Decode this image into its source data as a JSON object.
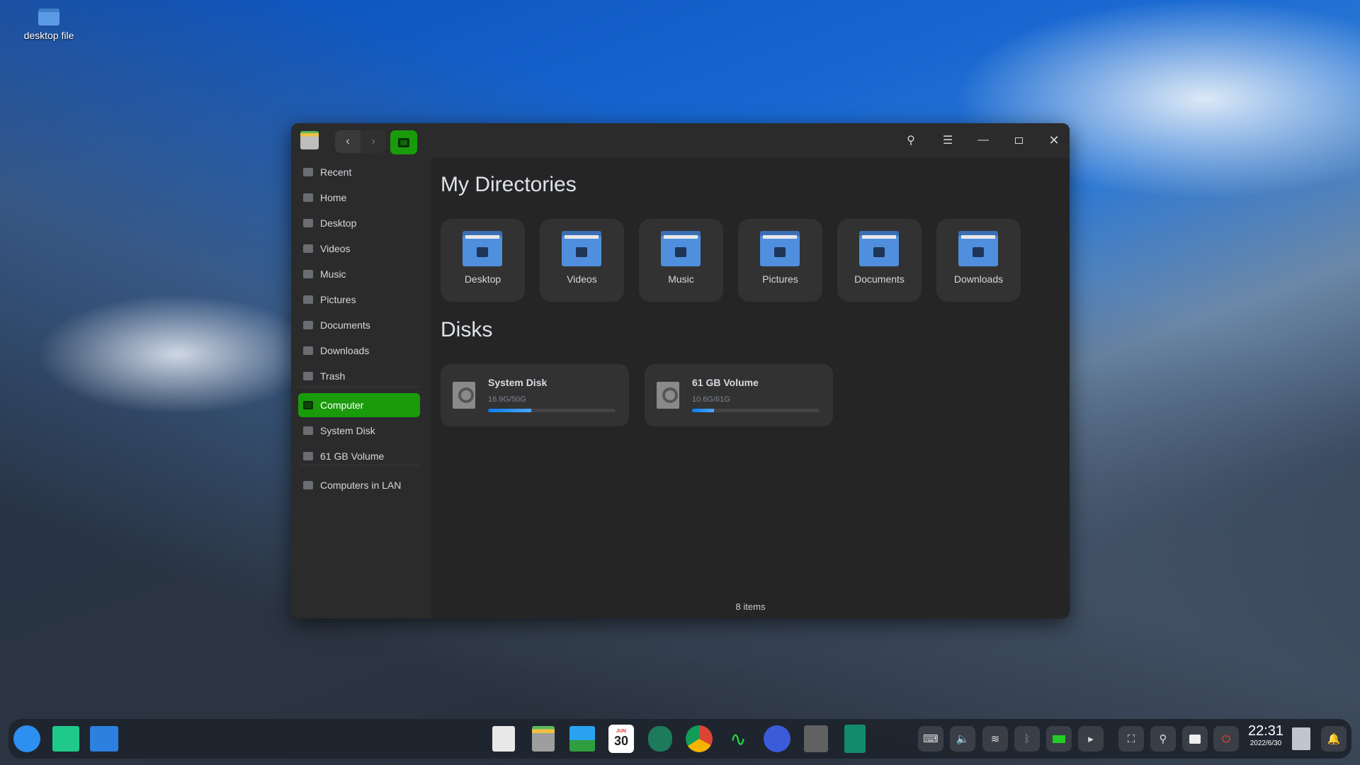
{
  "desktop": {
    "icon_label": "desktop file"
  },
  "window": {
    "nav": {
      "back": "back",
      "forward": "forward",
      "computer_view": "computer"
    },
    "sidebar": {
      "items": [
        {
          "label": "Recent",
          "icon": "clock-icon"
        },
        {
          "label": "Home",
          "icon": "home-icon"
        },
        {
          "label": "Desktop",
          "icon": "desktop-icon"
        },
        {
          "label": "Videos",
          "icon": "video-icon"
        },
        {
          "label": "Music",
          "icon": "music-icon"
        },
        {
          "label": "Pictures",
          "icon": "picture-icon"
        },
        {
          "label": "Documents",
          "icon": "document-icon"
        },
        {
          "label": "Downloads",
          "icon": "download-icon"
        },
        {
          "label": "Trash",
          "icon": "trash-icon"
        },
        {
          "label": "Computer",
          "icon": "computer-icon",
          "active": true
        },
        {
          "label": "System Disk",
          "icon": "disk-icon"
        },
        {
          "label": "61 GB Volume",
          "icon": "disk-icon"
        },
        {
          "label": "Computers in LAN",
          "icon": "network-icon"
        }
      ]
    },
    "main": {
      "directories_title": "My Directories",
      "directories": [
        {
          "label": "Desktop"
        },
        {
          "label": "Videos"
        },
        {
          "label": "Music"
        },
        {
          "label": "Pictures"
        },
        {
          "label": "Documents"
        },
        {
          "label": "Downloads"
        }
      ],
      "disks_title": "Disks",
      "disks": [
        {
          "name": "System Disk",
          "usage": "16.9G/50G",
          "used_fraction": 0.338
        },
        {
          "name": "61 GB Volume",
          "usage": "10.6G/61G",
          "used_fraction": 0.174
        }
      ],
      "status": "8 items"
    },
    "accent": "#1a9b0c"
  },
  "taskbar": {
    "clock": {
      "time": "22:31",
      "date": "2022/6/30"
    },
    "calendar_day": "30",
    "calendar_month": "JUN"
  }
}
